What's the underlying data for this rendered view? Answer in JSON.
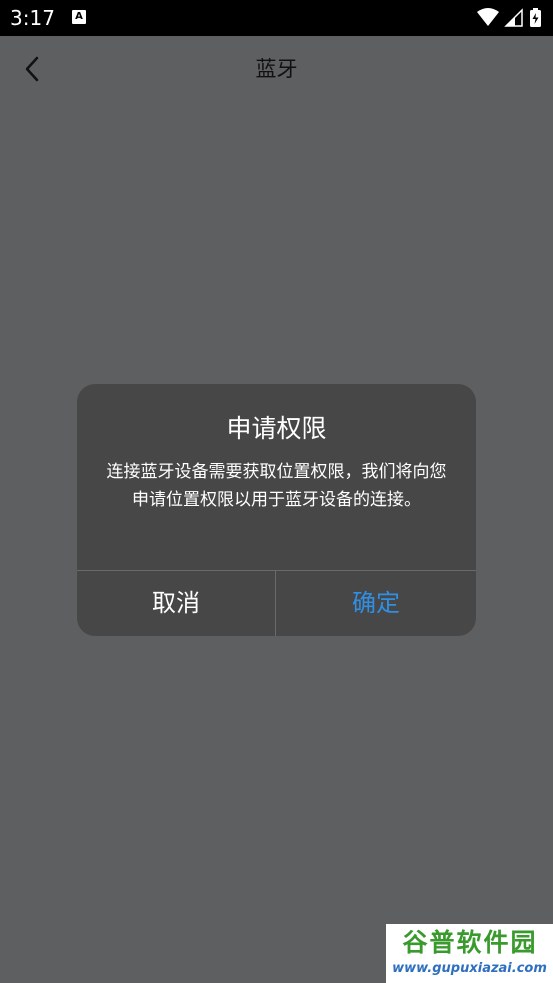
{
  "status_bar": {
    "time": "3:17",
    "notification_icon": "A",
    "icons": [
      "wifi-icon",
      "signal-icon",
      "battery-charging-icon"
    ]
  },
  "header": {
    "back_icon": "chevron-left-icon",
    "title": "蓝牙"
  },
  "dialog": {
    "title": "申请权限",
    "message": "连接蓝牙设备需要获取位置权限，我们将向您申请位置权限以用于蓝牙设备的连接。",
    "cancel_label": "取消",
    "confirm_label": "确定"
  },
  "watermark": {
    "title": "谷普软件园",
    "url": "www.gupuxiazai.com"
  },
  "colors": {
    "background": "#5e5f61",
    "dialog": "#474748",
    "accent": "#2f8fe3"
  }
}
